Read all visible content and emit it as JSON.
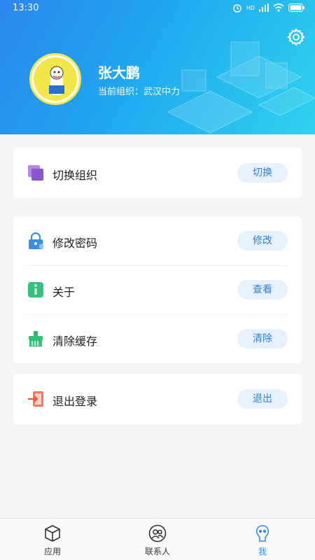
{
  "status_bar": {
    "time": "13:30",
    "network": "HD"
  },
  "profile": {
    "name": "张大鹏",
    "org_label": "当前组织：武汉中力"
  },
  "menu": {
    "switch_org": {
      "label": "切换组织",
      "action": "切换"
    },
    "change_password": {
      "label": "修改密码",
      "action": "修改"
    },
    "about": {
      "label": "关于",
      "action": "查看"
    },
    "clear_cache": {
      "label": "清除缓存",
      "action": "清除"
    },
    "logout": {
      "label": "退出登录",
      "action": "退出"
    }
  },
  "tabs": [
    {
      "label": "应用",
      "icon": "cube-icon"
    },
    {
      "label": "联系人",
      "icon": "contacts-icon"
    },
    {
      "label": "我",
      "icon": "me-icon",
      "active": true
    }
  ],
  "colors": {
    "accent": "#2f8ef0",
    "button_bg": "#e6f1fd",
    "button_text": "#2f7fd6"
  }
}
